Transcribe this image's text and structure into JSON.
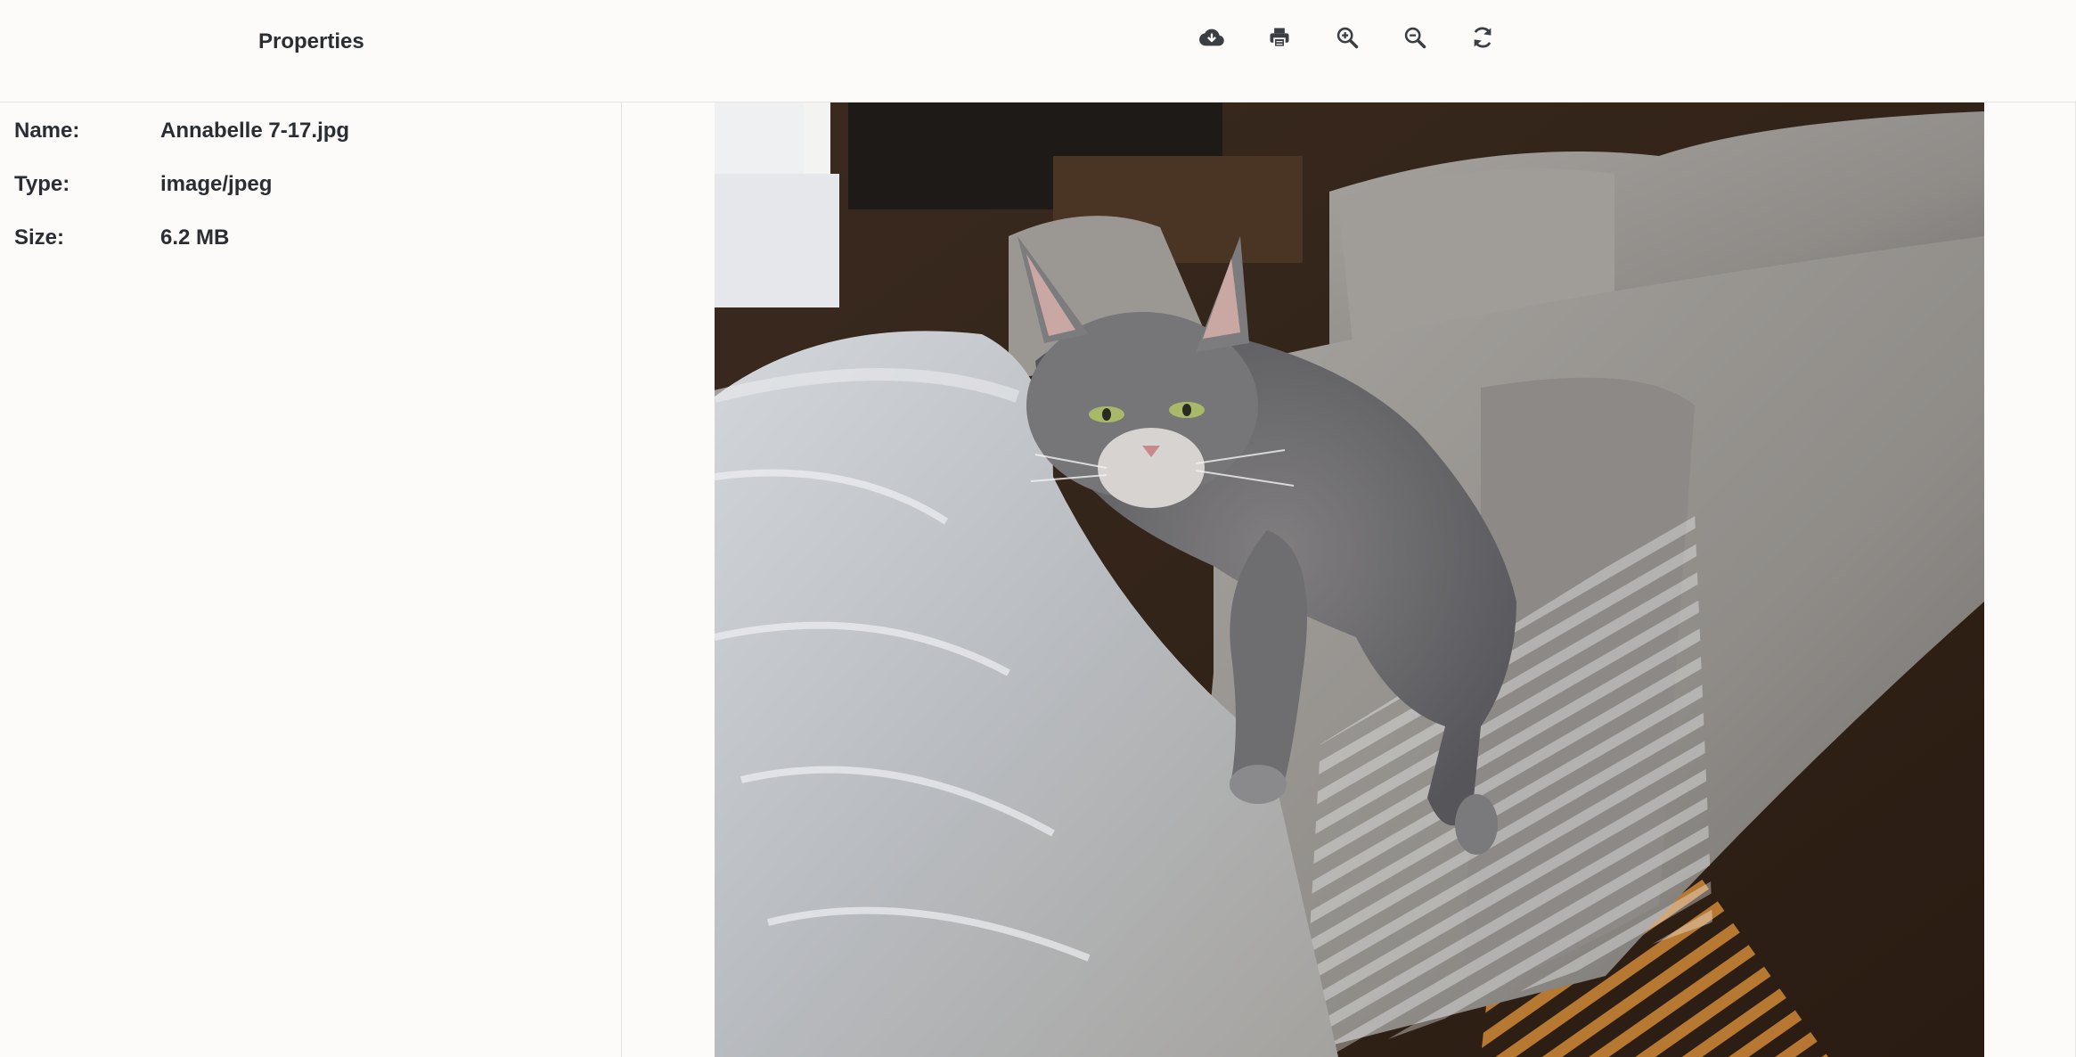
{
  "header": {
    "title": "Properties"
  },
  "toolbar": {
    "buttons": [
      {
        "name": "download",
        "icon": "cloud-download-icon"
      },
      {
        "name": "print",
        "icon": "printer-icon"
      },
      {
        "name": "zoom-in",
        "icon": "zoom-in-icon"
      },
      {
        "name": "zoom-out",
        "icon": "zoom-out-icon"
      },
      {
        "name": "rotate",
        "icon": "rotate-icon"
      }
    ],
    "icon_color": "#3b3f44"
  },
  "properties": {
    "name_label": "Name:",
    "name_value": "Annabelle 7-17.jpg",
    "type_label": "Type:",
    "type_value": "image/jpeg",
    "size_label": "Size:",
    "size_value": "6.2 MB"
  },
  "colors": {
    "background": "#fcfbfa",
    "divider": "#e6e4e1",
    "text": "#2a2e33"
  }
}
